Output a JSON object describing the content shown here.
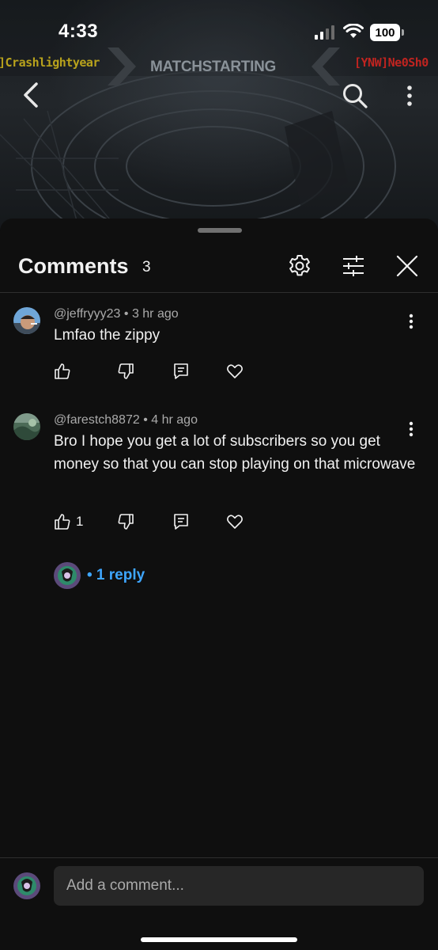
{
  "status_bar": {
    "time": "4:33",
    "battery": "100"
  },
  "video": {
    "player_left": "]Crashlightyear",
    "player_right": "[YNW]Ne0Sh0",
    "banner": "MATCHSTARTING"
  },
  "comments_panel": {
    "title": "Comments",
    "count": "3",
    "comments": [
      {
        "author": "@jeffryyy23",
        "time": "3 hr ago",
        "text": "Lmfao the zippy",
        "likes": ""
      },
      {
        "author": "@farestch8872",
        "time": "4 hr ago",
        "text": "Bro I hope you get a lot of subscribers so you get money so that you can stop playing on that microwave",
        "likes": "1",
        "replies_label": "• 1 reply"
      }
    ],
    "separator": "•"
  },
  "composer": {
    "placeholder": "Add a comment..."
  },
  "colors": {
    "background": "#0f0f0f",
    "link_blue": "#3ea6ff",
    "input_bg": "#272727",
    "meta_gray": "#aaaaaa"
  },
  "icons": {
    "header": [
      "back-arrow-icon",
      "search-icon",
      "more-vert-icon"
    ],
    "panel": [
      "settings-gear-icon",
      "filter-sliders-icon",
      "close-icon"
    ],
    "actions": [
      "thumbs-up-icon",
      "thumbs-down-icon",
      "reply-comment-icon",
      "heart-icon"
    ]
  }
}
